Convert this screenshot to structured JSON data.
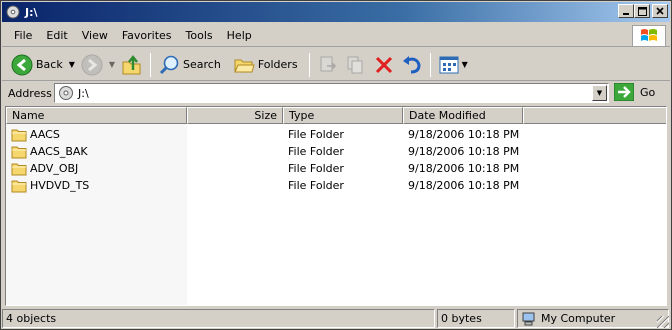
{
  "window": {
    "title": "J:\\",
    "minimize_icon": "minimize-icon",
    "maximize_icon": "maximize-icon",
    "close_icon": "close-icon"
  },
  "menu": [
    "File",
    "Edit",
    "View",
    "Favorites",
    "Tools",
    "Help"
  ],
  "toolbar": {
    "back_label": "Back",
    "search_label": "Search",
    "folders_label": "Folders"
  },
  "address": {
    "label": "Address",
    "value": "J:\\",
    "go_label": "Go"
  },
  "list": {
    "columns": {
      "name": "Name",
      "size": "Size",
      "type": "Type",
      "date": "Date Modified"
    },
    "items": [
      {
        "name": "AACS",
        "size": "",
        "type": "File Folder",
        "date": "9/18/2006 10:18 PM"
      },
      {
        "name": "AACS_BAK",
        "size": "",
        "type": "File Folder",
        "date": "9/18/2006 10:18 PM"
      },
      {
        "name": "ADV_OBJ",
        "size": "",
        "type": "File Folder",
        "date": "9/18/2006 10:18 PM"
      },
      {
        "name": "HVDVD_TS",
        "size": "",
        "type": "File Folder",
        "date": "9/18/2006 10:18 PM"
      }
    ]
  },
  "status": {
    "objects": "4 objects",
    "size": "0 bytes",
    "zone": "My Computer"
  },
  "colors": {
    "title_bar_start": "#0a246a",
    "title_bar_end": "#a6caf0",
    "chrome": "#d4d0c8",
    "folder": "#f5d76e"
  }
}
